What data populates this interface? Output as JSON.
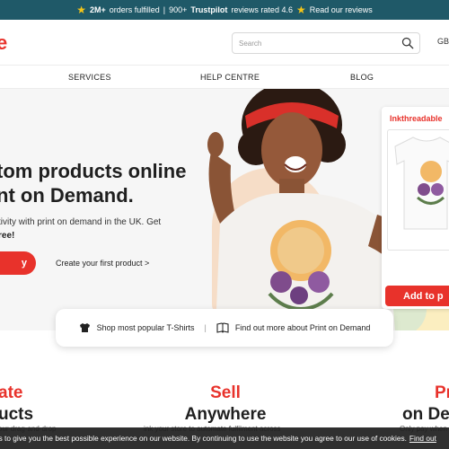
{
  "topbar": {
    "orders": "2M+",
    "orders_text": "orders fulfilled",
    "separator": "|",
    "reviews_count": "900+",
    "brand": "Trustpilot",
    "rating_text": "reviews rated 4.6",
    "read_reviews": "Read our reviews",
    "star_color": "#f5c518",
    "bg_color": "#1f5968"
  },
  "header": {
    "logo_fragment": "e",
    "search_placeholder": "Search",
    "region": "GBP"
  },
  "nav": {
    "services": "SERVICES",
    "help": "HELP CENTRE",
    "blog": "BLOG"
  },
  "hero": {
    "title_line1": "tom products online",
    "title_line2": "nt on Demand.",
    "body_line1": "tivity with print on demand in the UK. Get",
    "body_line2": "ree!",
    "cta_label": "y",
    "create_link": "Create your first product >",
    "card_label": "Inkthreadable",
    "card_button": "Add to p",
    "accent_color": "#e8322b"
  },
  "pill": {
    "tshirts": "Shop most popular T-Shirts",
    "sep": "|",
    "pod": "Find out more about Print on Demand"
  },
  "features": [
    {
      "line1": "ate",
      "line2": "ucts",
      "sub": "our drag-and-drop"
    },
    {
      "line1": "Sell",
      "line2": "Anywhere",
      "sub": "ink your store to automate fulfilment across"
    },
    {
      "line1": "Pr",
      "line2": "on De",
      "sub": "Only pay when"
    }
  ],
  "cookie": {
    "text": "kies to give you the best possible experience on our website. By continuing to use the website you agree to our use of cookies.",
    "link": "Find out"
  }
}
